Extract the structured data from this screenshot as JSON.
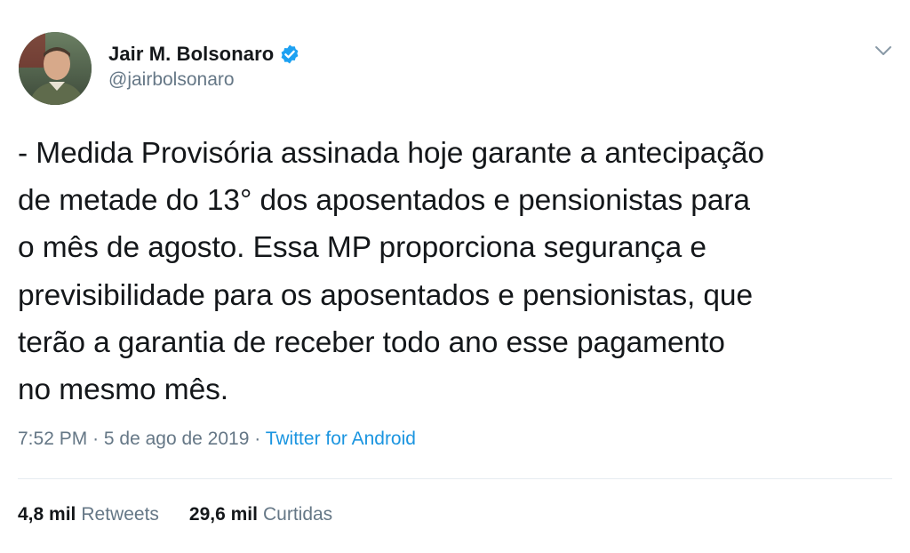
{
  "author": {
    "display_name": "Jair M. Bolsonaro",
    "handle": "@jairbolsonaro",
    "verified": true,
    "avatar_icon": "profile-photo"
  },
  "tweet": {
    "text": "- Medida Provisória assinada hoje garante a antecipação\nde metade do 13° dos aposentados e pensionistas para\no mês de agosto. Essa MP proporciona segurança e\nprevisibilidade para os aposentados e pensionistas, que\nterão a garantia de receber todo ano esse pagamento\nno mesmo mês.",
    "time": "7:52 PM",
    "separator": "·",
    "date": "5 de ago de 2019",
    "source": "Twitter for Android"
  },
  "stats": {
    "retweets_count": "4,8 mil",
    "retweets_label": "Retweets",
    "likes_count": "29,6 mil",
    "likes_label": "Curtidas"
  },
  "colors": {
    "text_primary": "#14171a",
    "text_secondary": "#657786",
    "link": "#1b95e0",
    "verified_badge": "#1da1f2",
    "divider": "#e6ecf0"
  },
  "icons": {
    "verified": "verified-badge-icon",
    "menu": "chevron-down-icon"
  }
}
